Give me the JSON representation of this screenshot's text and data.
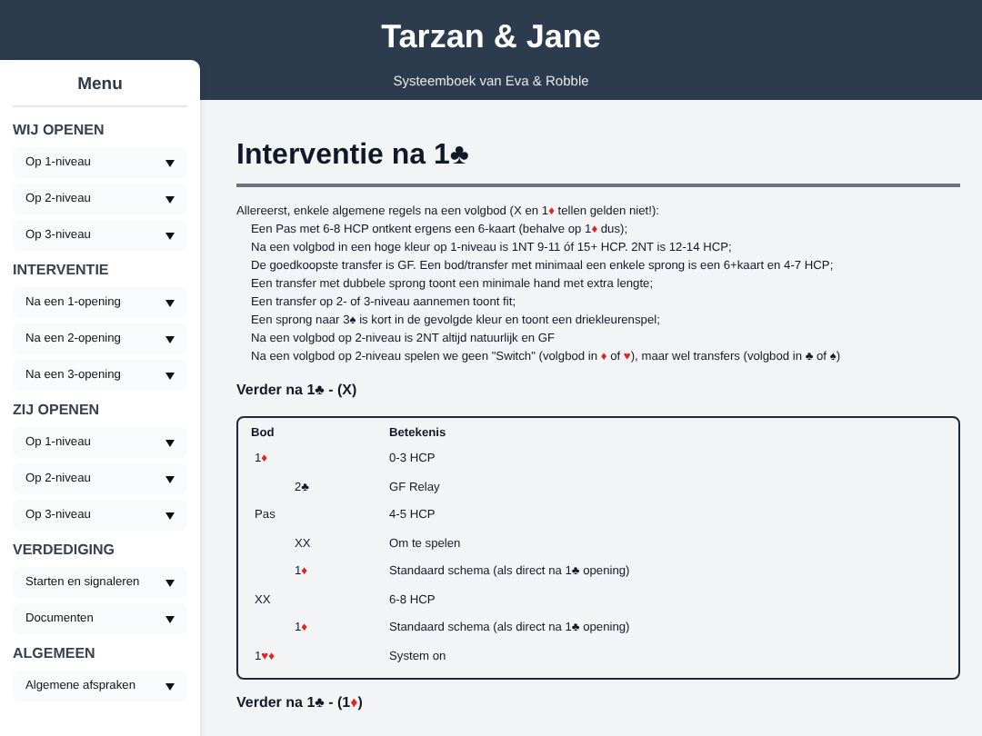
{
  "header": {
    "title": "Tarzan & Jane",
    "subtitle": "Systeemboek van Eva & Robble"
  },
  "sidebar": {
    "title": "Menu",
    "sections": [
      {
        "heading": "WIJ OPENEN",
        "items": [
          {
            "label": "Op 1-niveau"
          },
          {
            "label": "Op 2-niveau"
          },
          {
            "label": "Op 3-niveau"
          }
        ]
      },
      {
        "heading": "INTERVENTIE",
        "items": [
          {
            "label": "Na een 1-opening"
          },
          {
            "label": "Na een 2-opening"
          },
          {
            "label": "Na een 3-opening"
          }
        ]
      },
      {
        "heading": "ZIJ OPENEN",
        "items": [
          {
            "label": "Op 1-niveau"
          },
          {
            "label": "Op 2-niveau"
          },
          {
            "label": "Op 3-niveau"
          }
        ]
      },
      {
        "heading": "VERDEDIGING",
        "items": [
          {
            "label": "Starten en signaleren"
          },
          {
            "label": "Documenten"
          }
        ]
      },
      {
        "heading": "ALGEMEEN",
        "items": [
          {
            "label": "Algemene afspraken"
          }
        ]
      }
    ]
  },
  "main": {
    "heading": "Interventie na 1♣",
    "intro": "Allereerst, enkele algemene regels na een volgbod (X en 1♦ tellen gelden niet!):",
    "bullets": [
      "Een Pas met 6-8 HCP ontkent ergens een 6-kaart (behalve op 1♦ dus);",
      "Na een volgbod in een hoge kleur op 1-niveau is 1NT 9-11 óf 15+ HCP. 2NT is 12-14 HCP;",
      "De goedkoopste transfer is GF. Een bod/transfer met minimaal een enkele sprong is een 6+kaart en 4-7 HCP;",
      "Een transfer met dubbele sprong toont een minimale hand met extra lengte;",
      "Een transfer op 2- of 3-niveau aannemen toont fit;",
      "Een sprong naar 3♠ is kort in de gevolgde kleur en toont een driekleurenspel;",
      "Na een volgbod op 2-niveau is 2NT altijd natuurlijk en GF",
      "Na een volgbod op 2-niveau spelen we geen \"Switch\" (volgbod in ♦ of ♥), maar wel transfers (volgbod in ♣ of ♠)"
    ],
    "sections": [
      {
        "subheading": "Verder na 1♣ - (X)",
        "table": {
          "columns": [
            "Bod",
            "Betekenis"
          ],
          "rows": [
            {
              "bid": "1♦",
              "meaning": "0-3 HCP",
              "children": [
                {
                  "bid": "2♣",
                  "meaning": "GF Relay"
                }
              ]
            },
            {
              "bid": "Pas",
              "meaning": "4-5 HCP",
              "children": [
                {
                  "bid": "XX",
                  "meaning": "Om te spelen"
                },
                {
                  "bid": "1♦",
                  "meaning": "Standaard schema (als direct na 1♣ opening)"
                }
              ]
            },
            {
              "bid": "XX",
              "meaning": "6-8 HCP",
              "children": [
                {
                  "bid": "1♦",
                  "meaning": "Standaard schema (als direct na 1♣ opening)"
                }
              ]
            },
            {
              "bid": "1♥♦",
              "meaning": "System on"
            }
          ]
        }
      },
      {
        "subheading": "Verder na 1♣ - (1♦)"
      }
    ]
  }
}
